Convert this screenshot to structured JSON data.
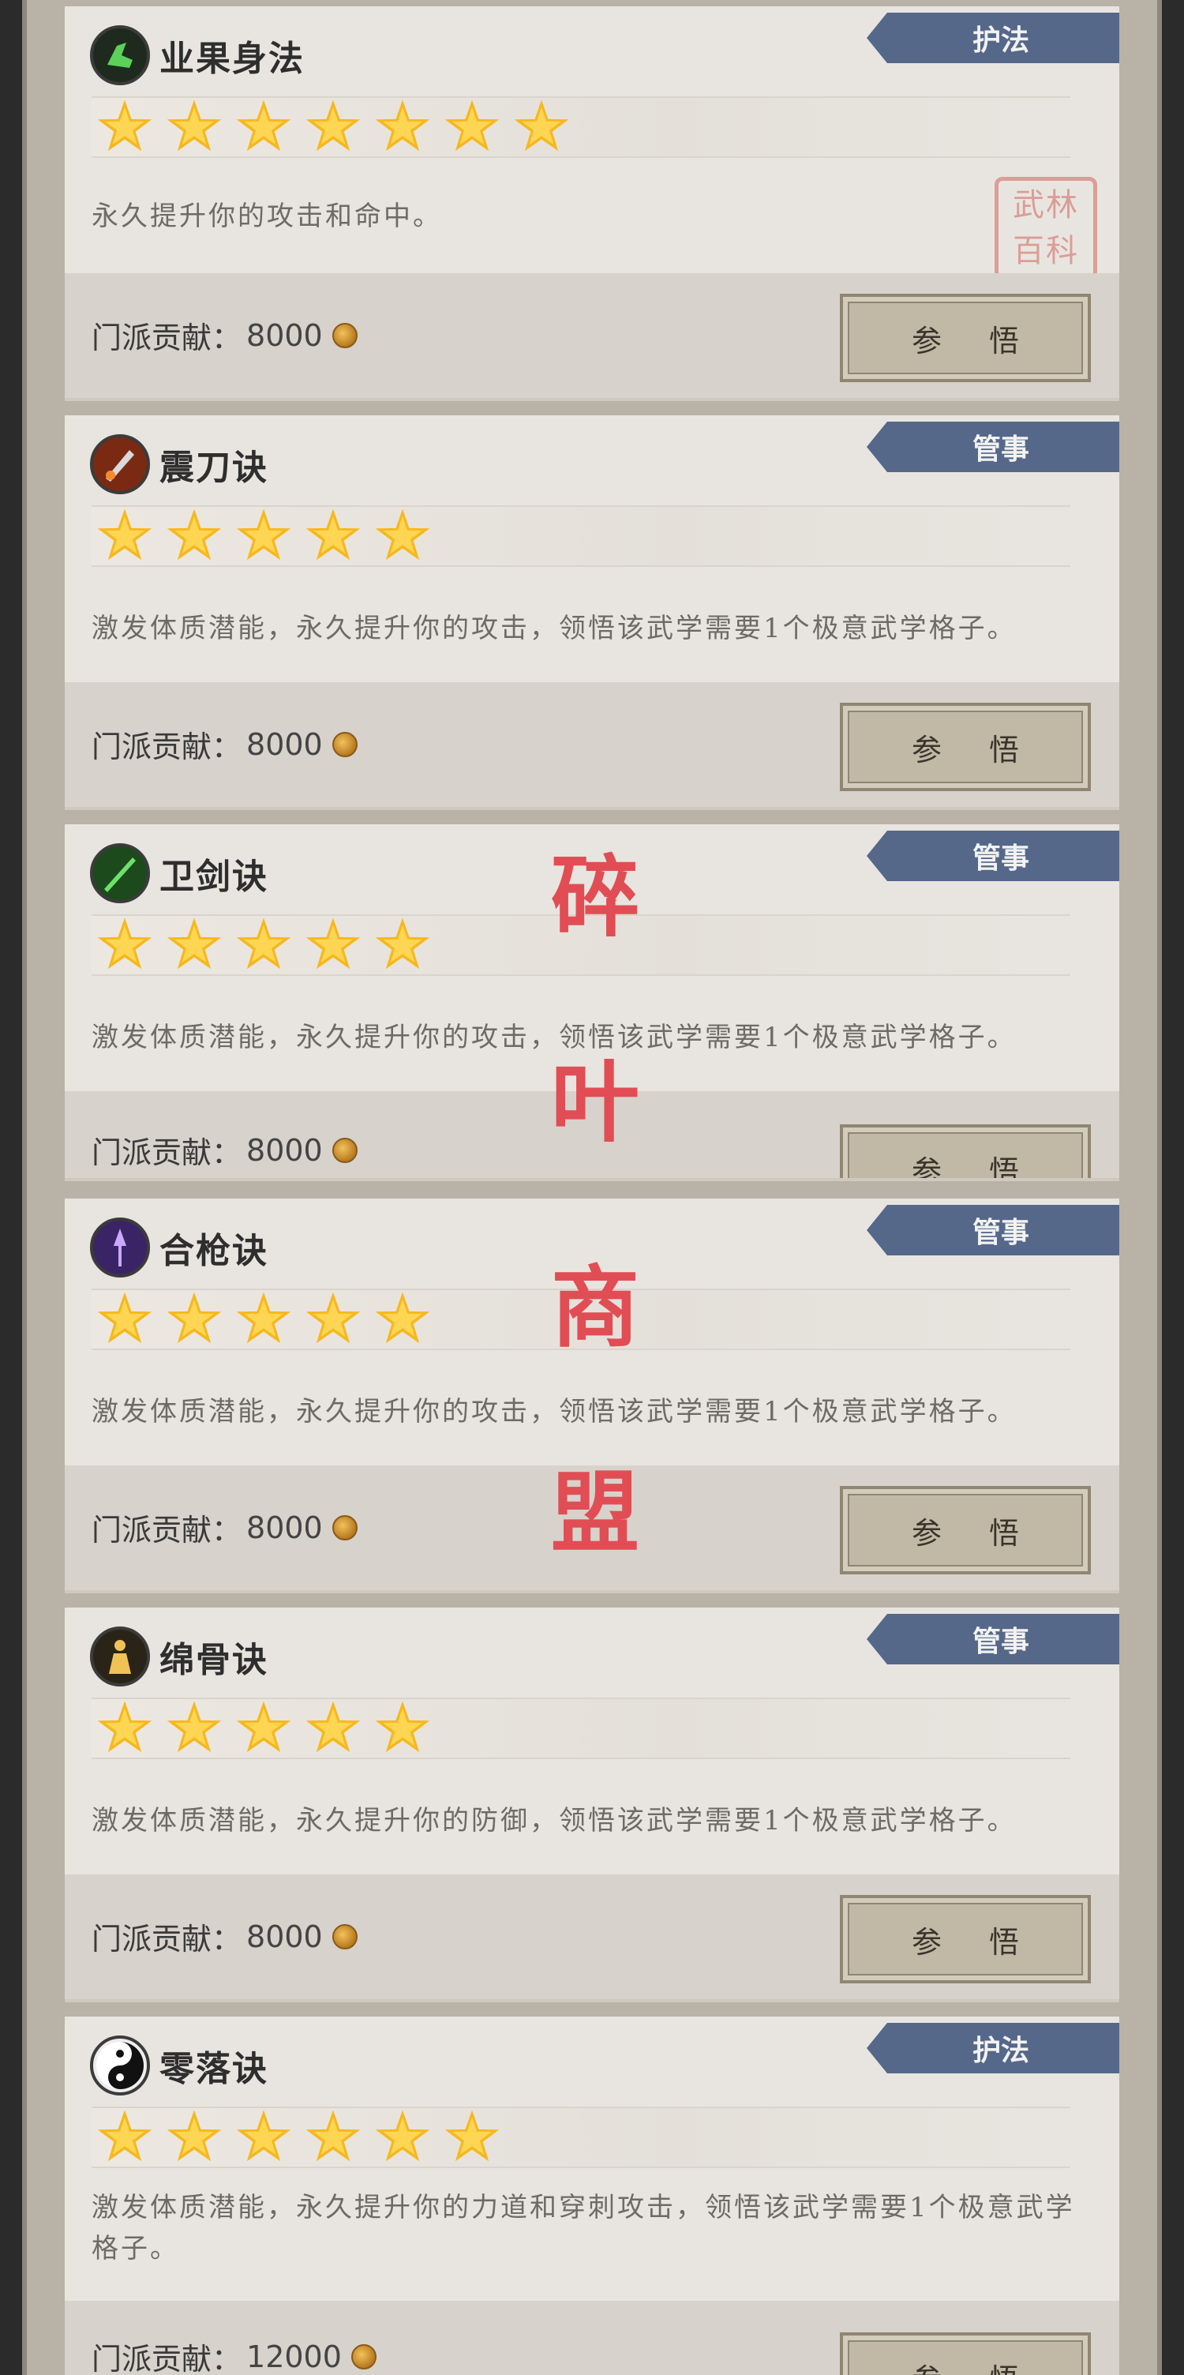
{
  "colors": {
    "tag": "#55688a",
    "star": "#f6b81e",
    "watermark": "#e14d54"
  },
  "cost_label": "门派贡献：",
  "learn_label": "参 悟",
  "cards": [
    {
      "tag": "护法",
      "name": "业果身法",
      "stars": 7,
      "icon": "green-boot-icon",
      "desc": "永久提升你的攻击和命中。",
      "cost": "8000",
      "seal": "武林百科"
    },
    {
      "tag": "管事",
      "name": "震刀诀",
      "stars": 5,
      "icon": "blade-icon",
      "desc": "激发体质潜能，永久提升你的攻击，领悟该武学需要1个极意武学格子。",
      "cost": "8000"
    },
    {
      "tag": "管事",
      "name": "卫剑诀",
      "stars": 5,
      "icon": "sword-icon",
      "desc": "激发体质潜能，永久提升你的攻击，领悟该武学需要1个极意武学格子。",
      "cost": "8000"
    },
    {
      "tag": "管事",
      "name": "合枪诀",
      "stars": 5,
      "icon": "spear-icon",
      "desc": "激发体质潜能，永久提升你的攻击，领悟该武学需要1个极意武学格子。",
      "cost": "8000"
    },
    {
      "tag": "管事",
      "name": "绵骨诀",
      "stars": 5,
      "icon": "monk-icon",
      "desc": "激发体质潜能，永久提升你的防御，领悟该武学需要1个极意武学格子。",
      "cost": "8000"
    },
    {
      "tag": "护法",
      "name": "零落诀",
      "stars": 6,
      "icon": "yin-yang-icon",
      "desc": "激发体质潜能，永久提升你的力道和穿刺攻击，领悟该武学需要1个极意武学格子。",
      "cost": "12000"
    }
  ],
  "watermark": [
    "碎",
    "叶",
    "商",
    "盟"
  ]
}
